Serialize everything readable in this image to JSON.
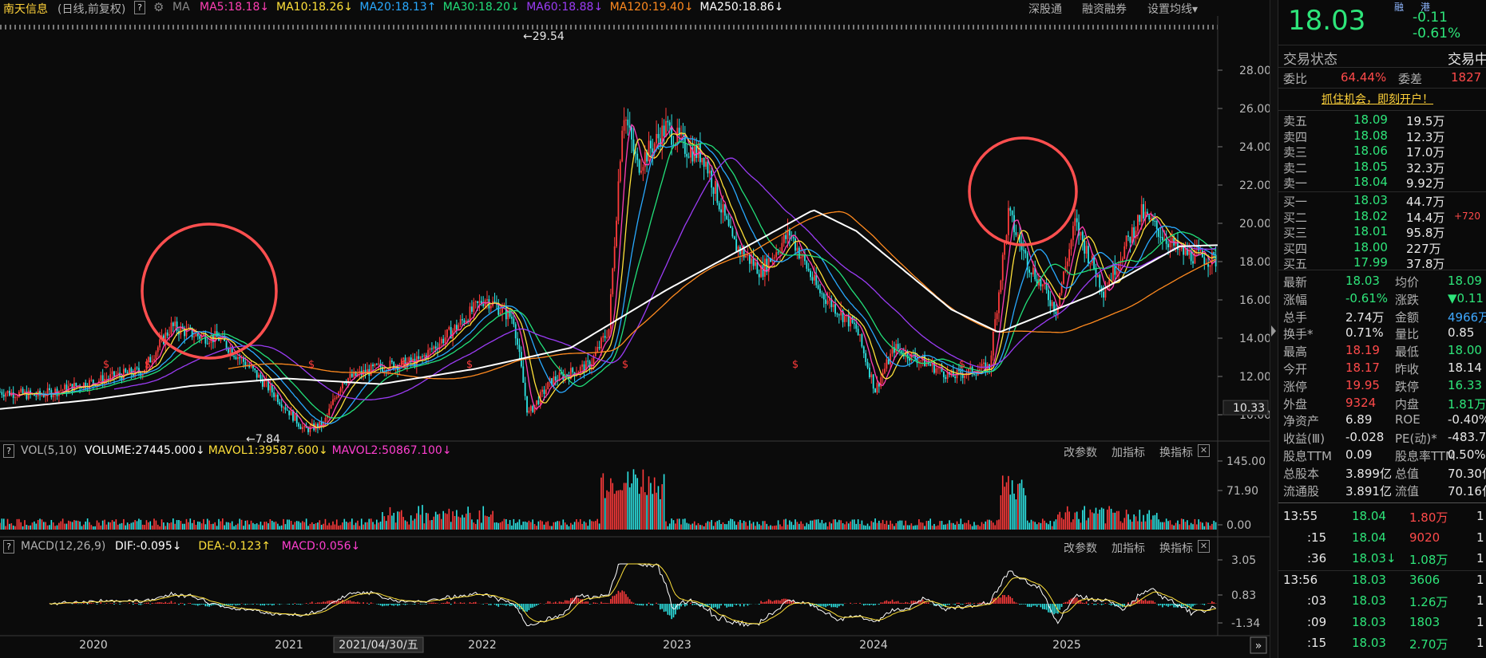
{
  "header": {
    "stock_name": "南天信息",
    "period": "(日线,前复权)",
    "help": "?",
    "ma_label": "MA",
    "ma_items": [
      {
        "label": "MA5:18.18",
        "arrow": "↓",
        "color": "#ff3fb4"
      },
      {
        "label": "MA10:18.26",
        "arrow": "↓",
        "color": "#ffe13a"
      },
      {
        "label": "MA20:18.13",
        "arrow": "↑",
        "color": "#29a9ff"
      },
      {
        "label": "MA30:18.20",
        "arrow": "↓",
        "color": "#22e07a"
      },
      {
        "label": "MA60:18.88",
        "arrow": "↓",
        "color": "#9b3cf5"
      },
      {
        "label": "MA120:19.40",
        "arrow": "↓",
        "color": "#ff8a1f"
      },
      {
        "label": "MA250:18.86",
        "arrow": "↓",
        "color": "#ffffff"
      }
    ],
    "links": [
      "深股通",
      "融资融券",
      "设置均线"
    ]
  },
  "chart_data": {
    "type": "candlestick",
    "x_ticks": [
      "2020",
      "2021",
      "2022",
      "2023",
      "2024",
      "2025"
    ],
    "y_ticks": [
      10.0,
      12.0,
      14.0,
      16.0,
      18.0,
      20.0,
      22.0,
      24.0,
      26.0,
      28.0
    ],
    "current_price_label": "10.33",
    "annotations": {
      "high": "←29.54",
      "low": "←7.84"
    },
    "cursor_date": "2021/04/30/五",
    "price_path": [
      [
        0,
        11.2
      ],
      [
        40,
        11.0
      ],
      [
        80,
        11.5
      ],
      [
        120,
        12.0
      ],
      [
        150,
        12.3
      ],
      [
        180,
        14.6
      ],
      [
        210,
        14.1
      ],
      [
        230,
        14.0
      ],
      [
        260,
        12.6
      ],
      [
        290,
        11.0
      ],
      [
        320,
        9.2
      ],
      [
        340,
        9.5
      ],
      [
        360,
        11.8
      ],
      [
        400,
        12.5
      ],
      [
        440,
        12.8
      ],
      [
        480,
        14.6
      ],
      [
        510,
        16.1
      ],
      [
        540,
        15.0
      ],
      [
        555,
        10.0
      ],
      [
        580,
        11.8
      ],
      [
        620,
        12.6
      ],
      [
        640,
        14.5
      ],
      [
        655,
        26.0
      ],
      [
        670,
        23.0
      ],
      [
        700,
        25.0
      ],
      [
        720,
        24.0
      ],
      [
        740,
        23.5
      ],
      [
        770,
        19.0
      ],
      [
        800,
        17.5
      ],
      [
        830,
        19.5
      ],
      [
        860,
        16.5
      ],
      [
        900,
        14.5
      ],
      [
        920,
        11.3
      ],
      [
        940,
        13.5
      ],
      [
        970,
        12.8
      ],
      [
        1000,
        12.0
      ],
      [
        1040,
        12.5
      ],
      [
        1060,
        20.5
      ],
      [
        1080,
        18.0
      ],
      [
        1110,
        15.5
      ],
      [
        1130,
        20.0
      ],
      [
        1160,
        16.5
      ],
      [
        1200,
        20.5
      ],
      [
        1240,
        18.5
      ],
      [
        1280,
        18.03
      ]
    ],
    "ma250_path": [
      [
        0,
        10.3
      ],
      [
        100,
        10.8
      ],
      [
        200,
        11.5
      ],
      [
        300,
        11.9
      ],
      [
        400,
        11.6
      ],
      [
        500,
        12.4
      ],
      [
        600,
        13.5
      ],
      [
        700,
        16.5
      ],
      [
        800,
        19.2
      ],
      [
        855,
        20.7
      ],
      [
        900,
        19.6
      ],
      [
        1000,
        15.5
      ],
      [
        1050,
        14.3
      ],
      [
        1150,
        16.3
      ],
      [
        1240,
        18.8
      ],
      [
        1280,
        18.86
      ]
    ],
    "volume": {
      "title": "VOL(5,10)",
      "items": [
        {
          "label": "VOLUME:27445.000",
          "arrow": "↓",
          "color": "#ffffff"
        },
        {
          "label": "MAVOL1:39587.600",
          "arrow": "↓",
          "color": "#ffe13a"
        },
        {
          "label": "MAVOL2:50867.100",
          "arrow": "↓",
          "color": "#ff3fd0"
        }
      ],
      "y_ticks": [
        "145.00",
        "71.90",
        "0.00"
      ],
      "buttons": [
        "改参数",
        "加指标",
        "换指标"
      ]
    },
    "macd": {
      "title": "MACD(12,26,9)",
      "items": [
        {
          "label": "DIF:-0.095",
          "arrow": "↓",
          "color": "#ffffff"
        },
        {
          "label": "DEA:-0.123",
          "arrow": "↑",
          "color": "#ffe13a"
        },
        {
          "label": "MACD:0.056",
          "arrow": "↓",
          "color": "#ff3fd0"
        }
      ],
      "y_ticks": [
        "3.05",
        "0.83",
        "-1.34"
      ],
      "buttons": [
        "改参数",
        "加指标",
        "换指标"
      ]
    }
  },
  "sidebar": {
    "price": "18.03",
    "change": "-0.11",
    "change_pct": "-0.61%",
    "tags": [
      "融",
      "港"
    ],
    "status_label": "交易状态",
    "status_value": "交易中",
    "weibi_label": "委比",
    "weibi_value": "64.44%",
    "weicha_label": "委差",
    "weicha_value": "1827",
    "promo": "抓住机会，即刻开户！",
    "asks": [
      {
        "label": "卖五",
        "price": "18.09",
        "vol": "19.5万"
      },
      {
        "label": "卖四",
        "price": "18.08",
        "vol": "12.3万"
      },
      {
        "label": "卖三",
        "price": "18.06",
        "vol": "17.0万"
      },
      {
        "label": "卖二",
        "price": "18.05",
        "vol": "32.3万"
      },
      {
        "label": "卖一",
        "price": "18.04",
        "vol": "9.92万"
      }
    ],
    "bids": [
      {
        "label": "买一",
        "price": "18.03",
        "vol": "44.7万",
        "extra": ""
      },
      {
        "label": "买二",
        "price": "18.02",
        "vol": "14.4万",
        "extra": "+720"
      },
      {
        "label": "买三",
        "price": "18.01",
        "vol": "95.8万",
        "extra": ""
      },
      {
        "label": "买四",
        "price": "18.00",
        "vol": "227万",
        "extra": ""
      },
      {
        "label": "买五",
        "price": "17.99",
        "vol": "37.8万",
        "extra": ""
      }
    ],
    "stats": [
      {
        "l1": "最新",
        "v1": "18.03",
        "c1": "green",
        "l2": "均价",
        "v2": "18.09",
        "c2": "green"
      },
      {
        "l1": "涨幅",
        "v1": "-0.61%",
        "c1": "green",
        "l2": "涨跌",
        "v2": "▼0.11",
        "c2": "green"
      },
      {
        "l1": "总手",
        "v1": "2.74万",
        "c1": "white",
        "l2": "金额",
        "v2": "4966万",
        "c2": "blue"
      },
      {
        "l1": "换手*",
        "v1": "0.71%",
        "c1": "white",
        "l2": "量比",
        "v2": "0.85",
        "c2": "white"
      },
      {
        "l1": "最高",
        "v1": "18.19",
        "c1": "red",
        "l2": "最低",
        "v2": "18.00",
        "c2": "green"
      },
      {
        "l1": "今开",
        "v1": "18.17",
        "c1": "red",
        "l2": "昨收",
        "v2": "18.14",
        "c2": "white"
      },
      {
        "l1": "涨停",
        "v1": "19.95",
        "c1": "red",
        "l2": "跌停",
        "v2": "16.33",
        "c2": "green"
      },
      {
        "l1": "外盘",
        "v1": "9324",
        "c1": "red",
        "l2": "内盘",
        "v2": "1.81万",
        "c2": "green"
      },
      {
        "l1": "净资产",
        "v1": "6.89",
        "c1": "white",
        "l2": "ROE",
        "v2": "-0.40%",
        "c2": "white"
      },
      {
        "l1": "收益(Ⅲ)",
        "v1": "-0.028",
        "c1": "white",
        "l2": "PE(动)*",
        "v2": "-483.70",
        "c2": "white"
      },
      {
        "l1": "股息TTM",
        "v1": "0.09",
        "c1": "white",
        "l2": "股息率TTM",
        "v2": "0.50%",
        "c2": "white"
      },
      {
        "l1": "总股本",
        "v1": "3.899亿",
        "c1": "white",
        "l2": "总值",
        "v2": "70.30亿",
        "c2": "white"
      },
      {
        "l1": "流通股",
        "v1": "3.891亿",
        "c1": "white",
        "l2": "流值",
        "v2": "70.16亿",
        "c2": "white"
      }
    ],
    "ticks": [
      {
        "time": "13:55",
        "price": "18.04",
        "vol": "1.80万",
        "vc": "red",
        "flag": "1"
      },
      {
        "time": ":15",
        "price": "18.04",
        "vol": "9020",
        "vc": "red",
        "flag": "1"
      },
      {
        "time": ":36",
        "price": "18.03↓",
        "vol": "1.08万",
        "vc": "green",
        "flag": "1"
      },
      {
        "time": "13:56",
        "price": "18.03",
        "vol": "3606",
        "vc": "green",
        "flag": "1"
      },
      {
        "time": ":03",
        "price": "18.03",
        "vol": "1.26万",
        "vc": "green",
        "flag": "1"
      },
      {
        "time": ":09",
        "price": "18.03",
        "vol": "1803",
        "vc": "green",
        "flag": "1"
      },
      {
        "time": ":15",
        "price": "18.03",
        "vol": "2.70万",
        "vc": "green",
        "flag": "1"
      }
    ]
  }
}
